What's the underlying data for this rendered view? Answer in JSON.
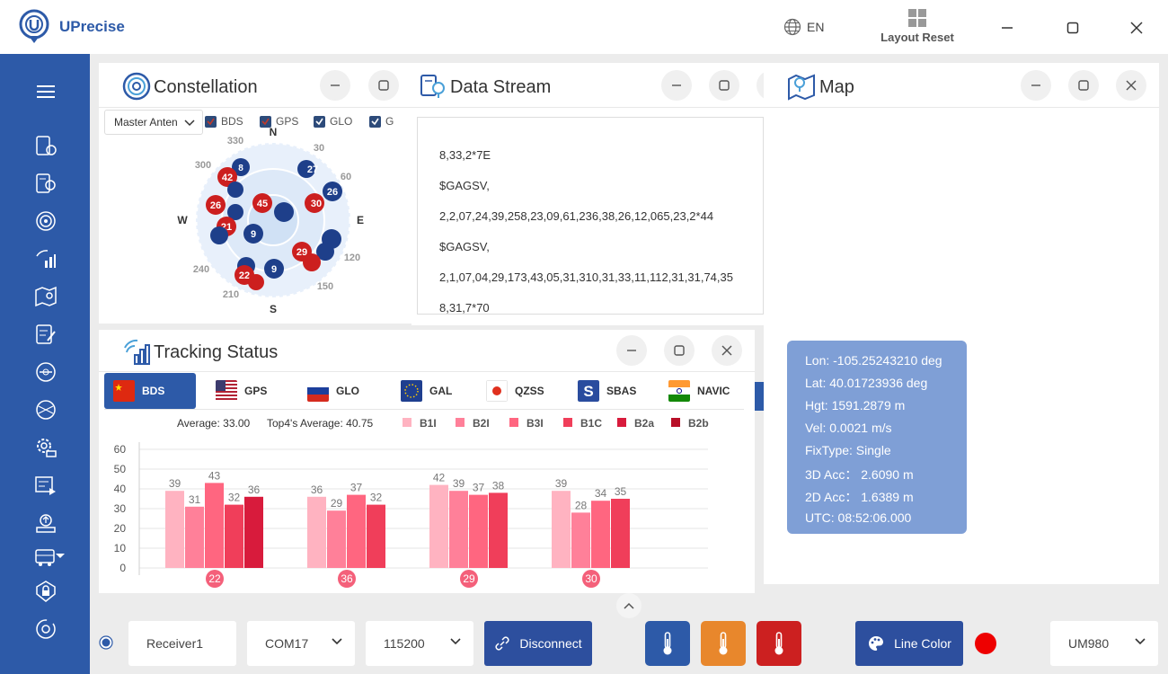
{
  "app": {
    "name": "UPrecise"
  },
  "topbar": {
    "language": "EN",
    "layout_reset": "Layout Reset"
  },
  "constellation": {
    "title": "Constellation",
    "antenna_select": "Master Anten",
    "filters": [
      {
        "label": "BDS",
        "checked": true
      },
      {
        "label": "GPS",
        "checked": true
      },
      {
        "label": "GLO",
        "checked": true
      },
      {
        "label": "G",
        "checked": true
      }
    ],
    "compass": {
      "N": "N",
      "E": "E",
      "S": "S",
      "W": "W"
    },
    "degree_labels": [
      "330",
      "30",
      "300",
      "60",
      "120",
      "240",
      "150",
      "210"
    ]
  },
  "data_stream": {
    "title": "Data Stream",
    "lines": [
      "8,33,2*7E",
      "$GAGSV,",
      "2,2,07,24,39,258,23,09,61,236,38,26,12,065,23,2*44",
      "$GAGSV,",
      "2,1,07,04,29,173,43,05,31,310,31,33,11,112,31,31,74,35",
      "8,31,7*70"
    ]
  },
  "map": {
    "title": "Map",
    "info": {
      "lon": "Lon: -105.25243210 deg",
      "lat": "Lat: 40.01723936 deg",
      "hgt": "Hgt: 1591.2879 m",
      "vel": "Vel: 0.0021 m/s",
      "fixtype": "FixType: Single",
      "acc3d": "3D Acc： 2.6090 m",
      "acc2d": "2D Acc： 1.6389 m",
      "utc": "UTC: 08:52:06.000"
    }
  },
  "tracking": {
    "title": "Tracking Status",
    "tabs": [
      {
        "label": "BDS",
        "active": true
      },
      {
        "label": "GPS",
        "active": false
      },
      {
        "label": "GLO",
        "active": false
      },
      {
        "label": "GAL",
        "active": false
      },
      {
        "label": "QZSS",
        "active": false
      },
      {
        "label": "SBAS",
        "active": false
      },
      {
        "label": "NAVIC",
        "active": false
      }
    ],
    "average_label": "Average:",
    "average_value": "33.00",
    "top4_label": "Top4's Average:",
    "top4_value": "40.75"
  },
  "chart_data": {
    "type": "bar",
    "categories": [
      "22",
      "36",
      "29",
      "30"
    ],
    "series": [
      {
        "name": "B1I",
        "color": "#ffb3c1",
        "values": [
          39,
          36,
          42,
          39
        ]
      },
      {
        "name": "B2I",
        "color": "#ff8099",
        "values": [
          31,
          29,
          39,
          28
        ]
      },
      {
        "name": "B3I",
        "color": "#ff6680",
        "values": [
          43,
          37,
          37,
          34
        ]
      },
      {
        "name": "B1C",
        "color": "#f03e5a",
        "values": [
          32,
          32,
          38,
          35
        ]
      },
      {
        "name": "B2a",
        "color": "#d81b3c",
        "values": [
          36,
          null,
          null,
          null
        ]
      },
      {
        "name": "B2b",
        "color": "#b80f28",
        "values": [
          null,
          null,
          null,
          null
        ]
      }
    ],
    "yticks": [
      0,
      10,
      20,
      30,
      40,
      50,
      60
    ],
    "ylim": [
      0,
      60
    ],
    "grid": true,
    "legend": "top"
  },
  "bottombar": {
    "receiver": "Receiver1",
    "port": "COM17",
    "baud": "115200",
    "disconnect": "Disconnect",
    "line_color": "Line Color",
    "device": "UM980",
    "thermo_colors": [
      "#2d5aa8",
      "#e8872c",
      "#cc2020"
    ],
    "status_dot_color": "#ee0000"
  }
}
